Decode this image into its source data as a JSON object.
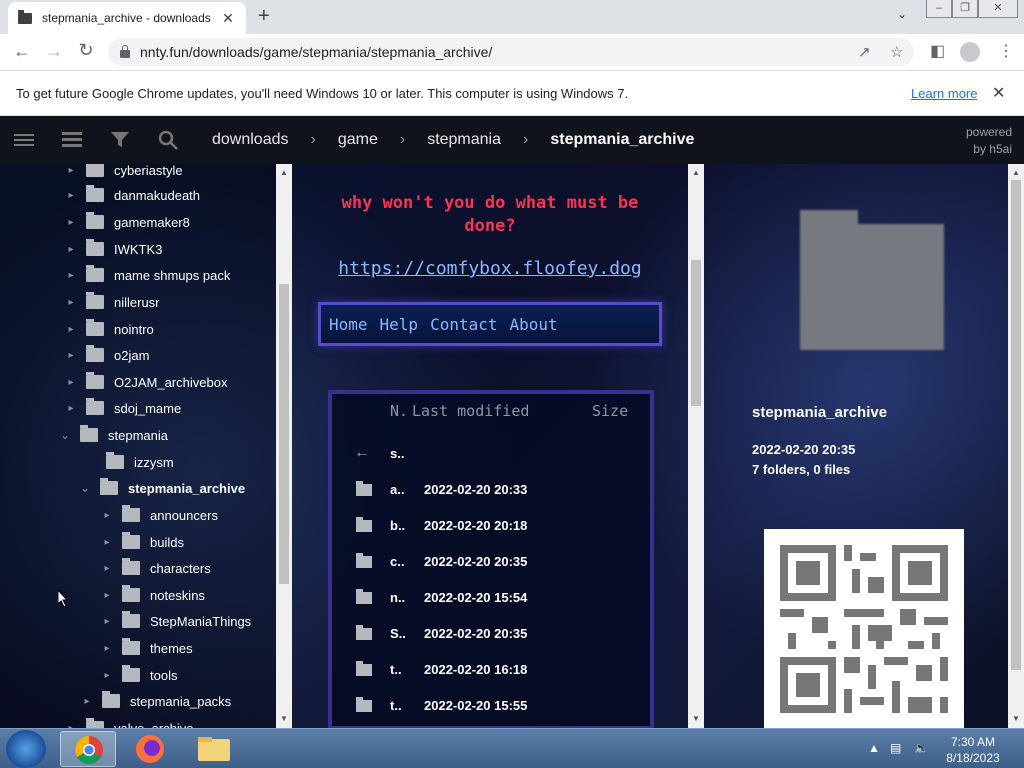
{
  "browser": {
    "tab_title": "stepmania_archive - downloads",
    "tab_close": "✕",
    "new_tab": "+",
    "url": "nnty.fun/downloads/game/stepmania/stepmania_archive/",
    "back": "←",
    "forward": "→",
    "reload": "↻"
  },
  "infobar": {
    "message": "To get future Google Chrome updates, you'll need Windows 10 or later. This computer is using Windows 7.",
    "learn_more": "Learn more",
    "close": "✕"
  },
  "header": {
    "breadcrumbs": [
      "downloads",
      "game",
      "stepmania",
      "stepmania_archive"
    ],
    "separator": "›",
    "powered_line1": "powered",
    "powered_line2": "by h5ai"
  },
  "sidebar": {
    "items": [
      {
        "label": "cyberiastyle",
        "depth": 0,
        "expanded": false
      },
      {
        "label": "danmakudeath",
        "depth": 0,
        "expanded": false
      },
      {
        "label": "gamemaker8",
        "depth": 0,
        "expanded": false
      },
      {
        "label": "IWKTK3",
        "depth": 0,
        "expanded": false
      },
      {
        "label": "mame shmups pack",
        "depth": 0,
        "expanded": false
      },
      {
        "label": "nillerusr",
        "depth": 0,
        "expanded": false
      },
      {
        "label": "nointro",
        "depth": 0,
        "expanded": false
      },
      {
        "label": "o2jam",
        "depth": 0,
        "expanded": false
      },
      {
        "label": "O2JAM_archivebox",
        "depth": 0,
        "expanded": false
      },
      {
        "label": "sdoj_mame",
        "depth": 0,
        "expanded": false
      },
      {
        "label": "stepmania",
        "depth": 0,
        "expanded": true
      },
      {
        "label": "izzysm",
        "depth": 1,
        "expanded": false
      },
      {
        "label": "stepmania_archive",
        "depth": 1,
        "expanded": true,
        "current": true
      },
      {
        "label": "announcers",
        "depth": 2,
        "expanded": false
      },
      {
        "label": "builds",
        "depth": 2,
        "expanded": false
      },
      {
        "label": "characters",
        "depth": 2,
        "expanded": false
      },
      {
        "label": "noteskins",
        "depth": 2,
        "expanded": false
      },
      {
        "label": "StepManiaThings",
        "depth": 2,
        "expanded": false
      },
      {
        "label": "themes",
        "depth": 2,
        "expanded": false
      },
      {
        "label": "tools",
        "depth": 2,
        "expanded": false
      },
      {
        "label": "stepmania_packs",
        "depth": 1,
        "expanded": false
      },
      {
        "label": "valve_archive",
        "depth": 0,
        "expanded": false
      }
    ]
  },
  "main": {
    "headline": "why won't you do what must be done?",
    "link": "https://comfybox.floofey.dog",
    "nav": [
      "Home",
      "Help",
      "Contact",
      "About"
    ],
    "columns": {
      "name": "N.",
      "modified": "Last modified",
      "size": "Size"
    },
    "rows": [
      {
        "name": "s..",
        "date": "",
        "parent": true
      },
      {
        "name": "a..",
        "date": "2022-02-20 20:33"
      },
      {
        "name": "b..",
        "date": "2022-02-20 20:18"
      },
      {
        "name": "c..",
        "date": "2022-02-20 20:35"
      },
      {
        "name": "n..",
        "date": "2022-02-20 15:54"
      },
      {
        "name": "S..",
        "date": "2022-02-20 20:35"
      },
      {
        "name": "t..",
        "date": "2022-02-20 16:18"
      },
      {
        "name": "t..",
        "date": "2022-02-20 15:55"
      }
    ]
  },
  "info": {
    "name": "stepmania_archive",
    "date": "2022-02-20 20:35",
    "count": "7 folders, 0 files"
  },
  "taskbar": {
    "time": "7:30 AM",
    "date": "8/18/2023"
  }
}
